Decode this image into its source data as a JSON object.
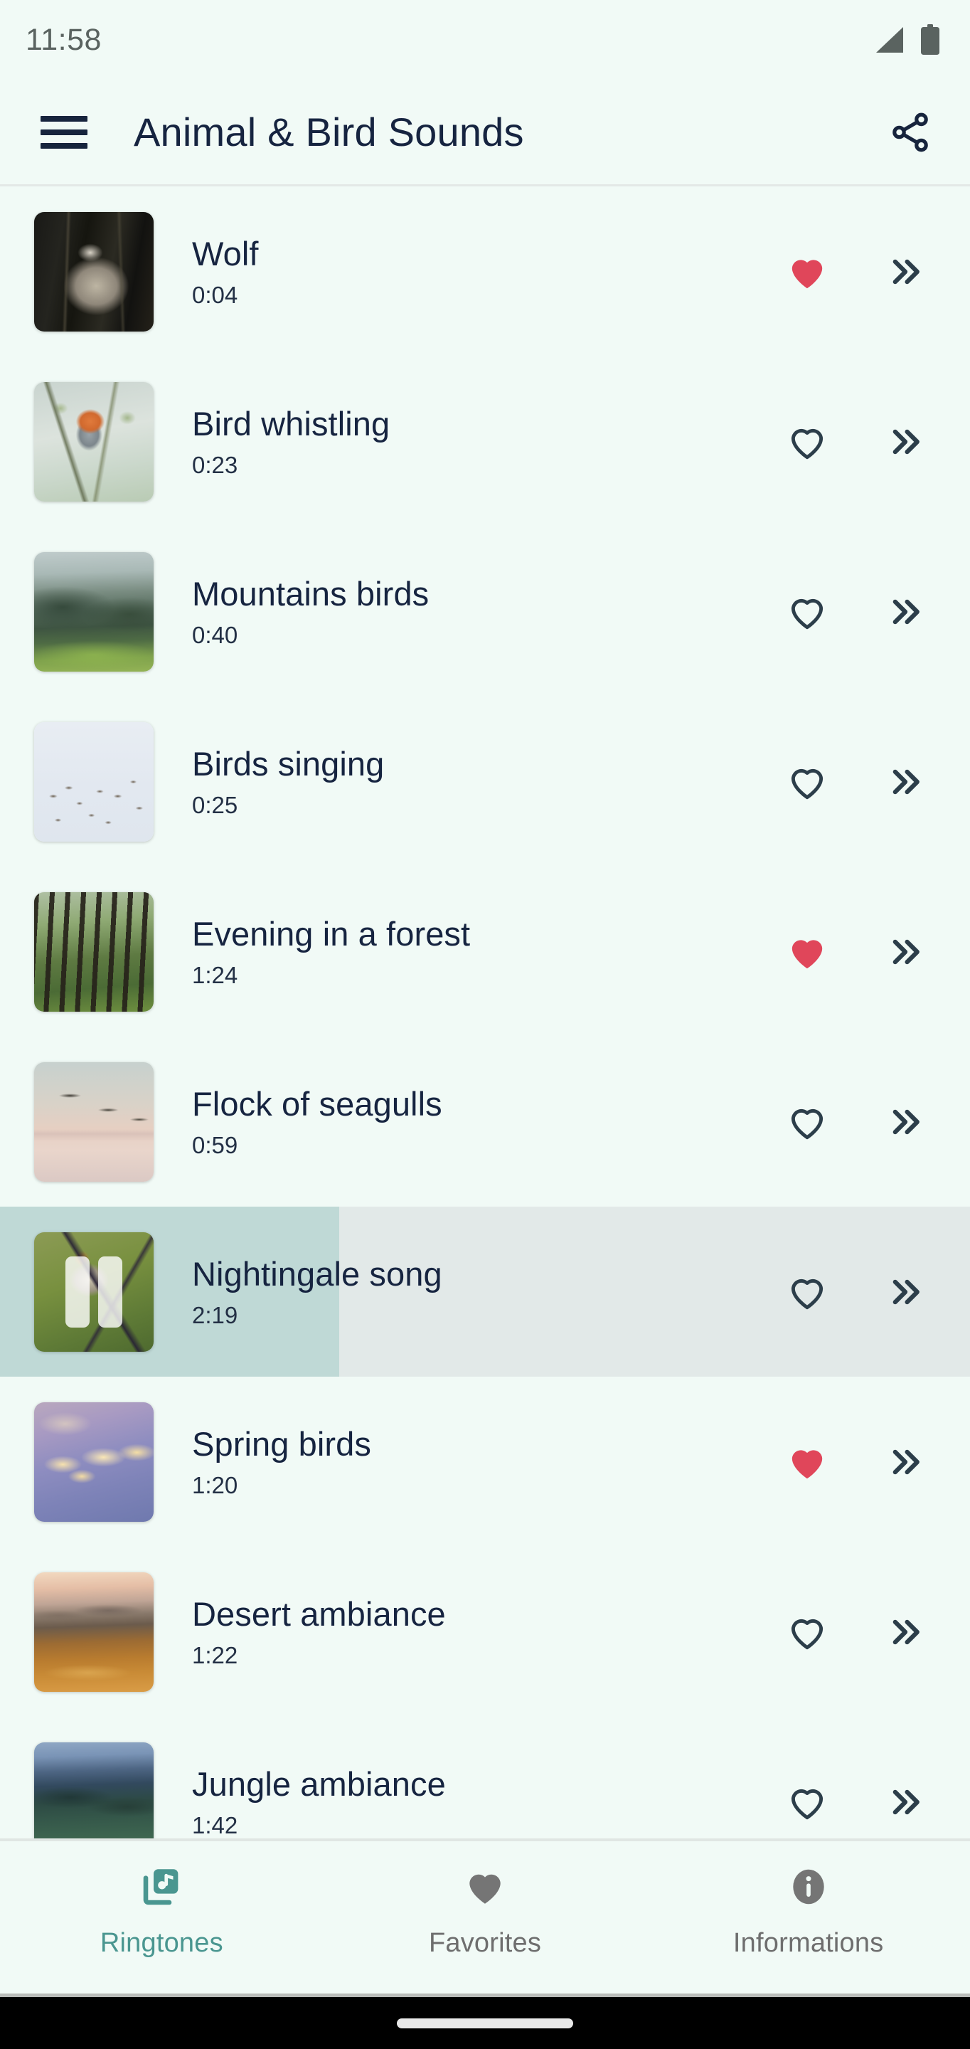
{
  "status_bar": {
    "time": "11:58",
    "signal_icon": "signal-bars-icon",
    "battery_icon": "battery-full-icon"
  },
  "app_bar": {
    "menu_icon": "hamburger-menu-icon",
    "title": "Animal & Bird Sounds",
    "share_icon": "share-icon"
  },
  "colors": {
    "background": "#F1FAF6",
    "title_text": "#162440",
    "accent_teal": "#4A9690",
    "favorite_red": "#E0465A",
    "icon_dark": "#2C3E4A",
    "progress_fill": "#BFD9D6",
    "progress_track": "#E2E9E8",
    "nav_inactive": "#6E6E6E"
  },
  "list": {
    "favorite_icon_filled": "heart-filled-icon",
    "favorite_icon_outline": "heart-outline-icon",
    "next_icon": "double-chevron-right-icon",
    "pause_icon": "pause-icon",
    "items": [
      {
        "title": "Wolf",
        "duration": "0:04",
        "favorite": true,
        "playing": false,
        "progress_percent": 0,
        "art": "art-wolf"
      },
      {
        "title": "Bird whistling",
        "duration": "0:23",
        "favorite": false,
        "playing": false,
        "progress_percent": 0,
        "art": "art-robin"
      },
      {
        "title": "Mountains birds",
        "duration": "0:40",
        "favorite": false,
        "playing": false,
        "progress_percent": 0,
        "art": "art-mountains"
      },
      {
        "title": "Birds singing",
        "duration": "0:25",
        "favorite": false,
        "playing": false,
        "progress_percent": 0,
        "art": "art-flyingbirds"
      },
      {
        "title": "Evening in a forest",
        "duration": "1:24",
        "favorite": true,
        "playing": false,
        "progress_percent": 0,
        "art": "art-forest"
      },
      {
        "title": "Flock of seagulls",
        "duration": "0:59",
        "favorite": false,
        "playing": false,
        "progress_percent": 0,
        "art": "art-seagulls"
      },
      {
        "title": "Nightingale song",
        "duration": "2:19",
        "favorite": false,
        "playing": true,
        "progress_percent": 35,
        "art": "art-nightingale"
      },
      {
        "title": "Spring birds",
        "duration": "1:20",
        "favorite": true,
        "playing": false,
        "progress_percent": 0,
        "art": "art-blossom"
      },
      {
        "title": "Desert ambiance",
        "duration": "1:22",
        "favorite": false,
        "playing": false,
        "progress_percent": 0,
        "art": "art-desert"
      },
      {
        "title": "Jungle ambiance",
        "duration": "1:42",
        "favorite": false,
        "playing": false,
        "progress_percent": 0,
        "art": "art-jungle"
      }
    ]
  },
  "bottom_nav": {
    "items": [
      {
        "label": "Ringtones",
        "icon": "music-library-icon",
        "active": true
      },
      {
        "label": "Favorites",
        "icon": "heart-filled-icon",
        "active": false
      },
      {
        "label": "Informations",
        "icon": "info-circle-icon",
        "active": false
      }
    ]
  },
  "gesture_bar": {
    "handle": "home-gesture-pill"
  }
}
